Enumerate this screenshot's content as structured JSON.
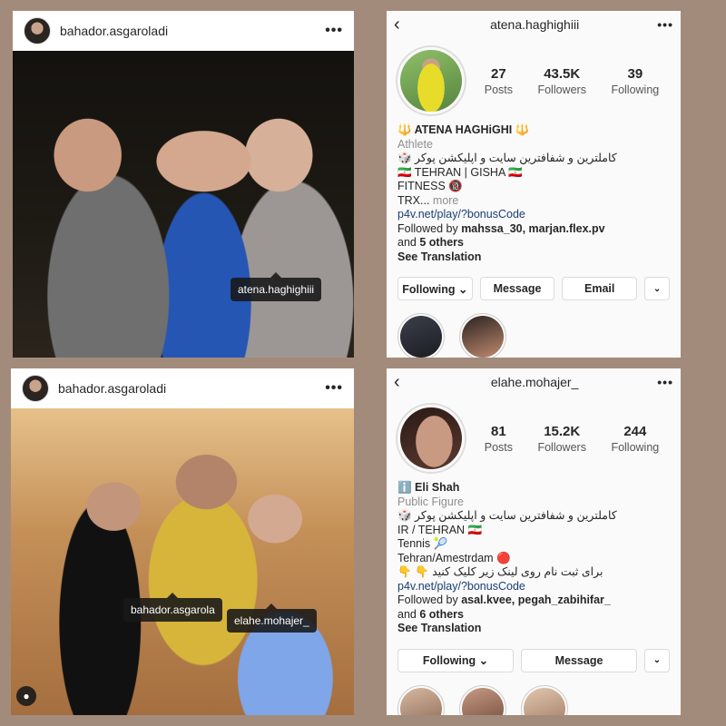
{
  "panels": {
    "post1": {
      "username": "bahador.asgaroladi",
      "more": "•••",
      "tags": [
        "atena.haghighiii"
      ]
    },
    "profile1": {
      "back": "‹",
      "username": "atena.haghighiii",
      "more": "•••",
      "stats": [
        {
          "num": "27",
          "label": "Posts"
        },
        {
          "num": "43.5K",
          "label": "Followers"
        },
        {
          "num": "39",
          "label": "Following"
        }
      ],
      "bio": {
        "name": "🔱 ATENA HAGHiGHI 🔱",
        "category": "Athlete",
        "line1": "کاملترین و شفافترین سایت و اپلیکشن پوکر 🎲",
        "line2": "🇮🇷 TEHRAN | GISHA 🇮🇷",
        "line3": "FITNESS 🔞",
        "line4_text": "TRX...",
        "line4_more": "more",
        "link": "p4v.net/play/?bonusCode",
        "followed_prefix": "Followed by",
        "followed_users": "mahssa_30, marjan.flex.pv",
        "followed_and": "and",
        "followed_others": "5 others",
        "see_translation": "See Translation"
      },
      "buttons": {
        "following": "Following ⌄",
        "message": "Message",
        "email": "Email",
        "chevron": "⌄"
      }
    },
    "post2": {
      "username": "bahador.asgaroladi",
      "more": "•••",
      "tags": [
        "bahador.asgarola",
        "elahe.mohajer_"
      ]
    },
    "profile2": {
      "back": "‹",
      "username": "elahe.mohajer_",
      "more": "•••",
      "stats": [
        {
          "num": "81",
          "label": "Posts"
        },
        {
          "num": "15.2K",
          "label": "Followers"
        },
        {
          "num": "244",
          "label": "Following"
        }
      ],
      "bio": {
        "name": "ℹ️ Eli Shah",
        "category": "Public Figure",
        "line1": "کاملترین و شفافترین سایت و اپلیکشن پوکر 🎲",
        "line2": "IR / TEHRAN 🇮🇷",
        "line3": "Tennis 🎾",
        "line4": "Tehran/Amestrdam 🔴",
        "line5": "برای ثبت نام روی لینک زیر کلیک کنید 👇 👇",
        "link": "p4v.net/play/?bonusCode",
        "followed_prefix": "Followed by",
        "followed_users": "asal.kvee, pegah_zabihifar_",
        "followed_and": "and",
        "followed_others": "6 others",
        "see_translation": "See Translation"
      },
      "buttons": {
        "following": "Following ⌄",
        "message": "Message",
        "chevron": "⌄"
      }
    }
  }
}
